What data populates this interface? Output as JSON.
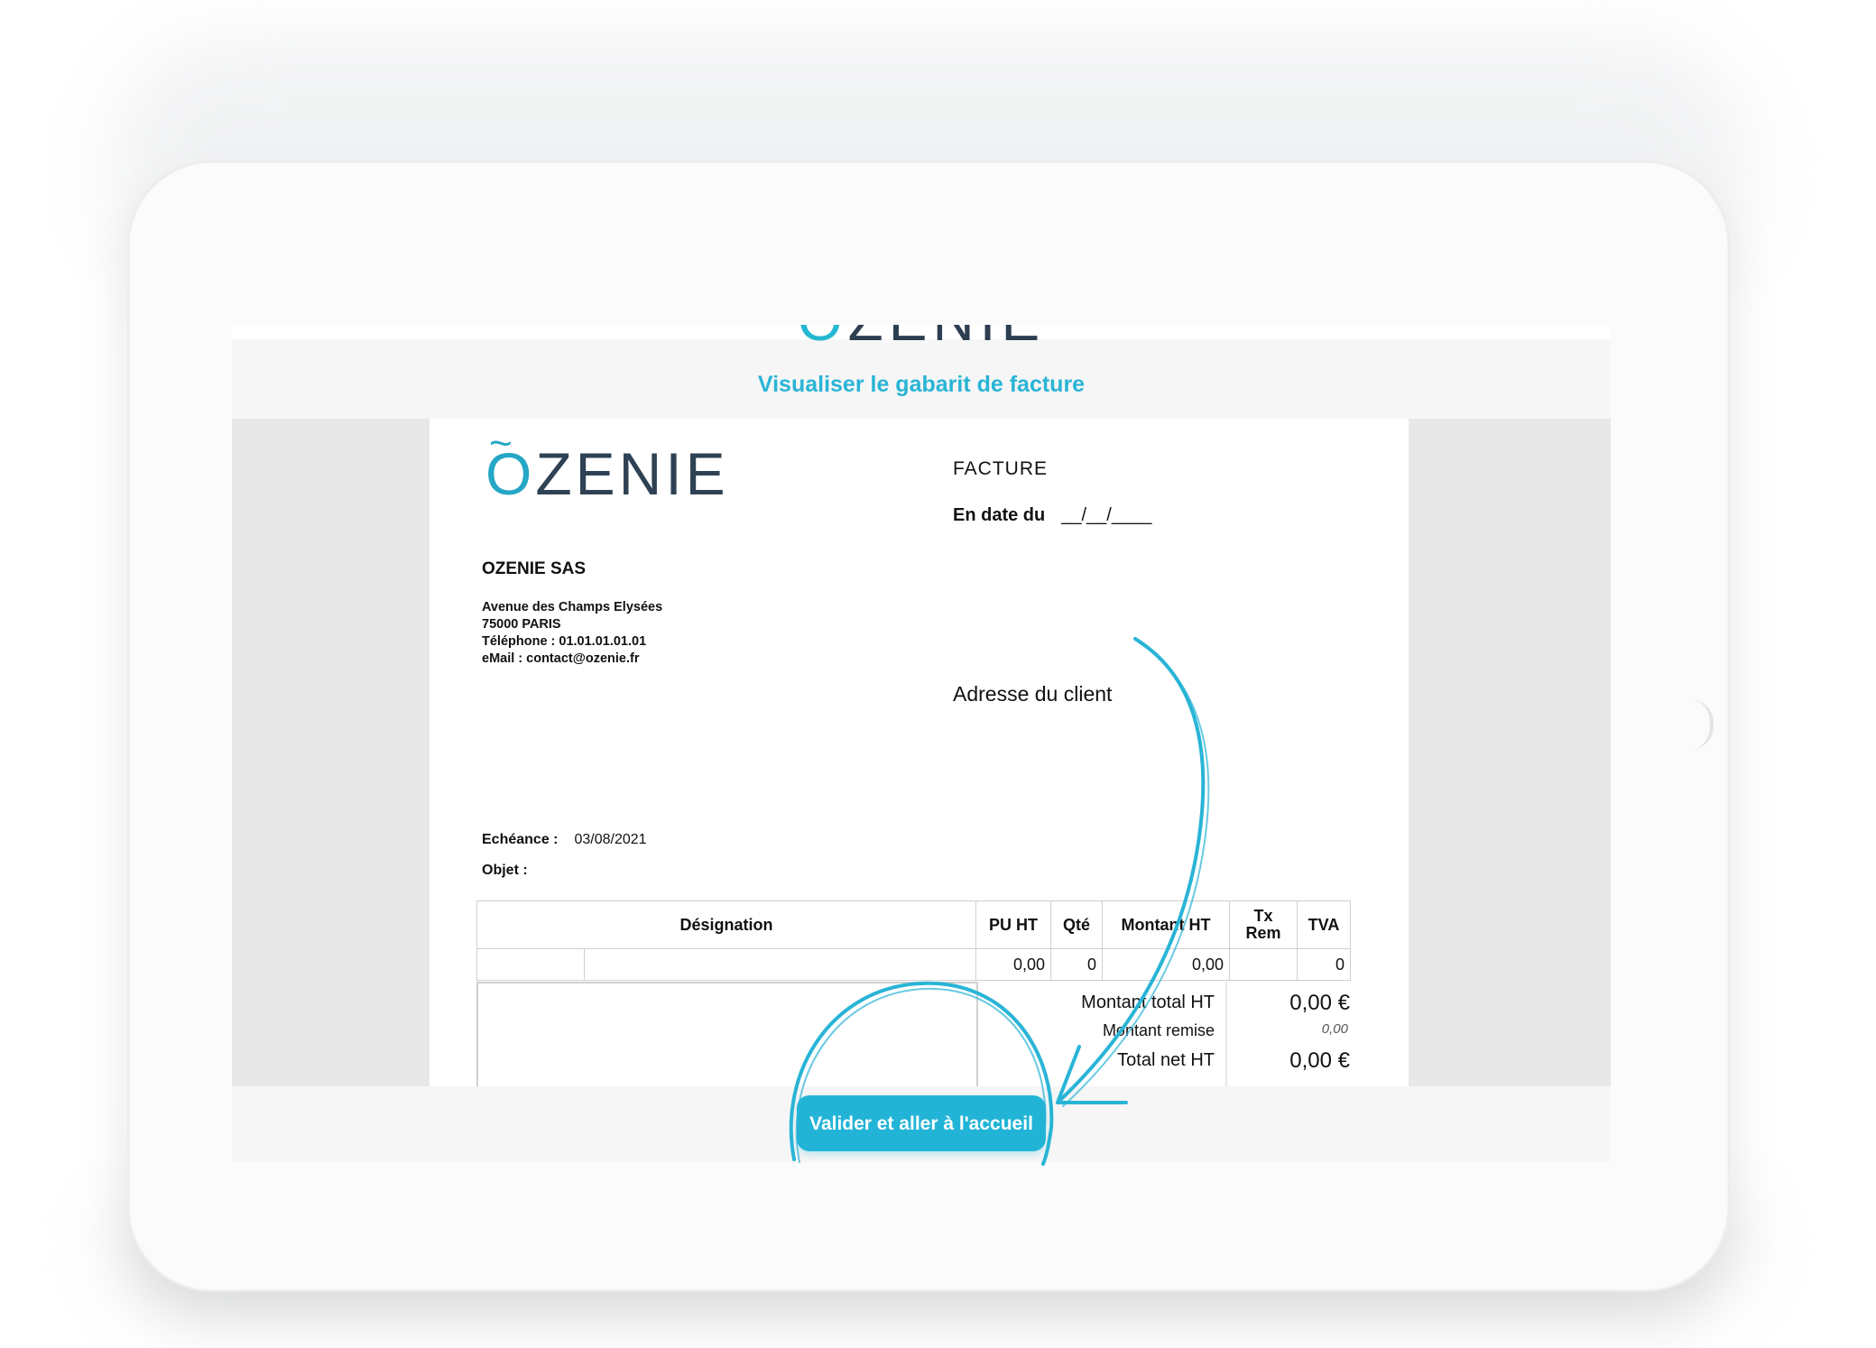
{
  "brand": {
    "accent": "#29b4d6",
    "logo_text": "ÕZENIE",
    "logo_o": "O",
    "logo_rest": "ZENIE"
  },
  "screen": {
    "title": "Visualiser le gabarit de facture",
    "cta_label": "Valider et aller à l'accueil"
  },
  "invoice": {
    "company_name": "OZENIE SAS",
    "address_lines": [
      "Avenue des Champs Elysées",
      "75000  PARIS",
      "Téléphone : 01.01.01.01.01",
      "eMail  : contact@ozenie.fr"
    ],
    "doc_type": "FACTURE",
    "date_label": "En date du",
    "date_value": "__/__/____",
    "client_address_label": "Adresse du client",
    "due_label": "Echéance :",
    "due_value": "03/08/2021",
    "object_label": "Objet :",
    "columns": [
      "Désignation",
      "PU HT",
      "Qté",
      "Montant HT",
      "Tx Rem",
      "TVA"
    ],
    "row": {
      "code": "",
      "designation": "",
      "pu_ht": "0,00",
      "qte": "0",
      "montant_ht": "0,00",
      "tx_rem": "",
      "tva": "0"
    },
    "totals": {
      "total_ht_label": "Montant total HT",
      "total_ht_value": "0,00 €",
      "remise_label": "Montant remise",
      "remise_value": "0,00",
      "net_ht_label": "Total net HT",
      "net_ht_value": "0,00 €"
    }
  }
}
